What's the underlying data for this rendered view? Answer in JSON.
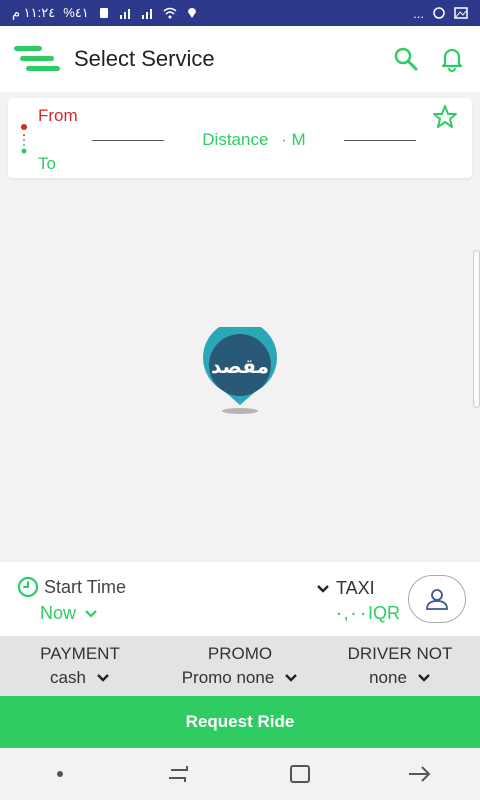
{
  "status_bar": {
    "left_text": "١١:٢٤ م",
    "battery_text": "%٤١",
    "right_text": "..."
  },
  "header": {
    "title": "Select Service",
    "icons": [
      "menu-icon",
      "search-icon",
      "bell-icon"
    ]
  },
  "route": {
    "from_label": "From",
    "to_label": "To",
    "distance_label": "Distance",
    "distance_unit": "· M"
  },
  "map": {
    "pin_text": "مقصد"
  },
  "service": {
    "start_time_label": "Start Time",
    "start_time_value": "Now",
    "vehicle_label": "TAXI",
    "price_text": "۰,۰۰IQR"
  },
  "options": [
    {
      "label": "PAYMENT",
      "value": "cash"
    },
    {
      "label": "PROMO",
      "value": "Promo none"
    },
    {
      "label": "DRIVER NOT",
      "value": "none"
    }
  ],
  "request_button": "Request Ride",
  "colors": {
    "brand_green": "#2ecc63",
    "from_red": "#d62828",
    "status_bar": "#2d3a8c",
    "pin_teal": "#2ba8b8"
  }
}
